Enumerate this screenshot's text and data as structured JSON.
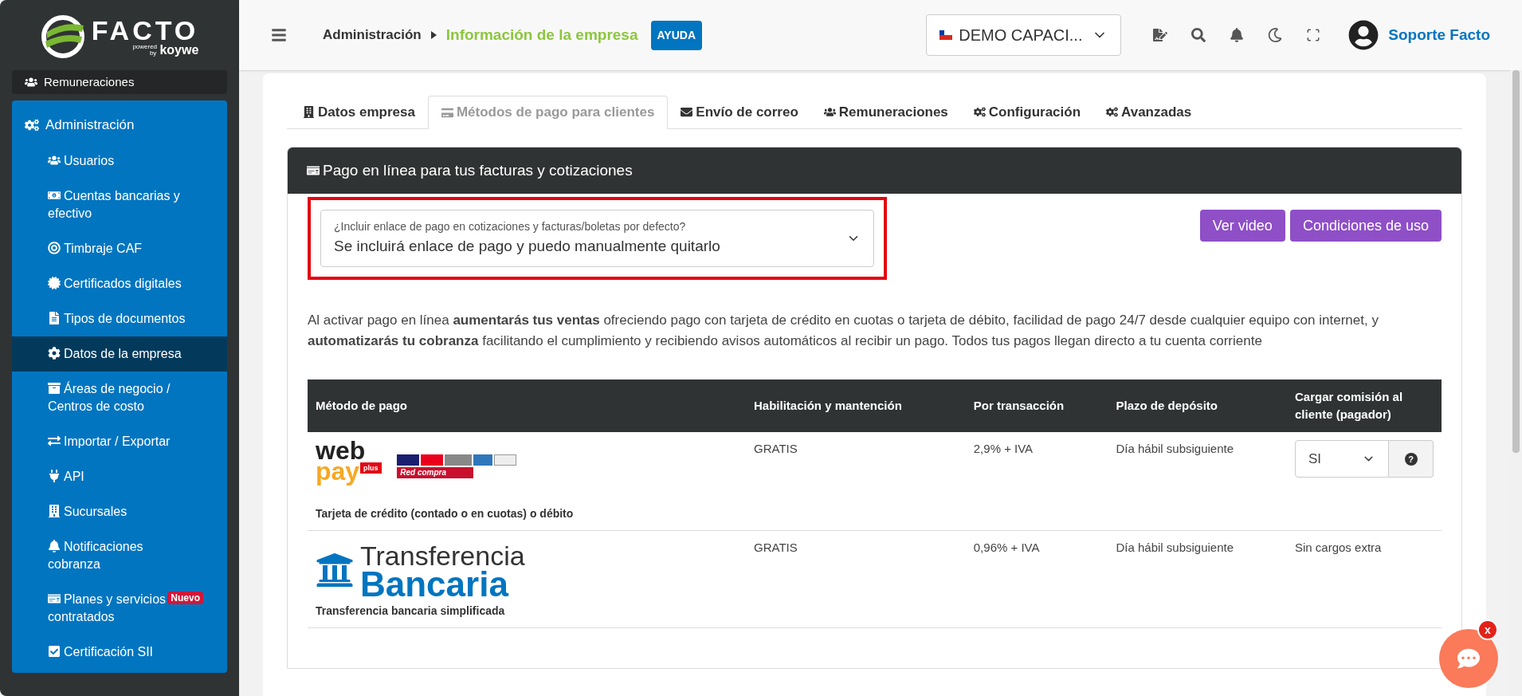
{
  "logo": {
    "name": "FACTO",
    "powered": "powered by",
    "brand": "koywe"
  },
  "sidebar": {
    "prev_item": "Remuneraciones",
    "section": "Administración",
    "items": [
      {
        "label": "Usuarios",
        "selected": false
      },
      {
        "label": "Cuentas bancarias y efectivo",
        "selected": false
      },
      {
        "label": "Timbraje CAF",
        "selected": false
      },
      {
        "label": "Certificados digitales",
        "selected": false
      },
      {
        "label": "Tipos de documentos",
        "selected": false
      },
      {
        "label": "Datos de la empresa",
        "selected": true
      },
      {
        "label": "Áreas de negocio / Centros de costo",
        "selected": false
      },
      {
        "label": "Importar / Exportar",
        "selected": false
      },
      {
        "label": "API",
        "selected": false
      },
      {
        "label": "Sucursales",
        "selected": false
      },
      {
        "label": "Notificaciones cobranza",
        "selected": false
      },
      {
        "label": "Planes y servicios contratados",
        "selected": false,
        "badge": "Nuevo"
      },
      {
        "label": "Certificación SII",
        "selected": false
      }
    ]
  },
  "header": {
    "breadcrumb": [
      "Administración",
      "Información de la empresa"
    ],
    "help": "AYUDA",
    "company": "DEMO CAPACI...",
    "user": "Soporte Facto"
  },
  "tabs": [
    {
      "label": "Datos empresa",
      "selected": false
    },
    {
      "label": "Métodos de pago para clientes",
      "selected": true
    },
    {
      "label": "Envío de correo",
      "selected": false
    },
    {
      "label": "Remuneraciones",
      "selected": false
    },
    {
      "label": "Configuración",
      "selected": false
    },
    {
      "label": "Avanzadas",
      "selected": false
    }
  ],
  "panel": {
    "title": "Pago en línea para tus facturas y cotizaciones",
    "select": {
      "label": "¿Incluir enlace de pago en cotizaciones y facturas/boletas por defecto?",
      "value": "Se incluirá enlace de pago y puedo manualmente quitarlo",
      "highlighted": true
    },
    "buttons": [
      "Ver video",
      "Condiciones de uso"
    ],
    "description": "Al activar pago en línea **aumentarás tus ventas** ofreciendo pago con tarjeta de crédito en cuotas o tarjeta de débito, facilidad de pago 24/7 desde cualquier equipo con internet, y **automatizarás tu cobranza** facilitando el cumplimiento y recibiendo avisos automáticos al recibir un pago. Todos tus pagos llegan directo a tu cuenta corriente",
    "table": {
      "columns": [
        "Método de pago",
        "Habilitación y mantención",
        "Por transacción",
        "Plazo de depósito",
        "Cargar comisión al cliente (pagador)"
      ],
      "rows": [
        {
          "kind": "webpay",
          "logo": [
            "web",
            "pay",
            "plus",
            "Red compra"
          ],
          "method": "Tarjeta de crédito (contado o en cuotas) o débito",
          "setup": "GRATIS",
          "fee": "2,9% + IVA",
          "deposit": "Día hábil subsiguiente",
          "charge": {
            "kind": "select",
            "value": "SI",
            "help": "?"
          }
        },
        {
          "kind": "transfer",
          "logo": [
            "Transferencia",
            "Bancaria"
          ],
          "method": "Transferencia bancaria simplificada",
          "setup": "GRATIS",
          "fee": "0,96% + IVA",
          "deposit": "Día hábil subsiguiente",
          "charge": {
            "kind": "text",
            "value": "Sin cargos extra"
          }
        }
      ]
    }
  },
  "chat": {
    "badge": "x"
  }
}
